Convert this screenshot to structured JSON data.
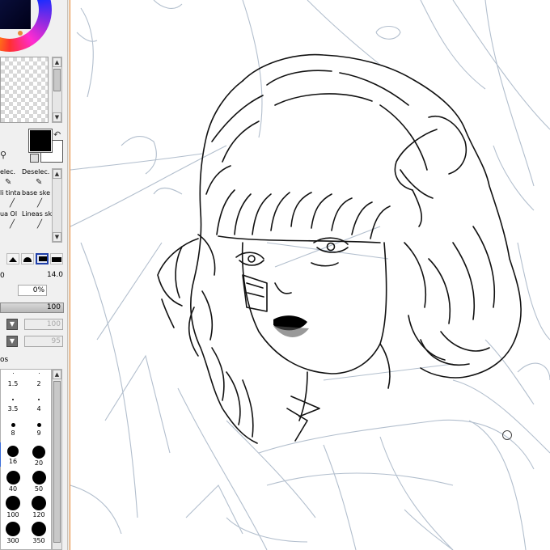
{
  "panel": {
    "tools": {
      "row1": [
        "elec.",
        "Deselec."
      ],
      "row2": [
        "li tinta",
        "base ske"
      ],
      "row3": [
        "ua Ol",
        "Lineas sk"
      ]
    },
    "brush_size": "14.0",
    "size_left": "0",
    "min_size": "0%",
    "density": "100",
    "blend_dropdown_1": "100",
    "blend_dropdown_2": "95",
    "brush_panel_label": "os",
    "brush_sizes": [
      "1.5",
      "2",
      "3.5",
      "4",
      "8",
      "9",
      "16",
      "20",
      "40",
      "50",
      "100",
      "120",
      "300",
      "350"
    ]
  },
  "colors": {
    "foreground": "#000000",
    "background": "#ffffff",
    "accent": "#e88a3a",
    "selection": "#1f3fa8",
    "sketch_line": "#aab8c8"
  }
}
